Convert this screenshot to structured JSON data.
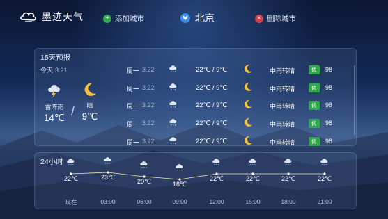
{
  "header": {
    "app_name": "墨迹天气",
    "add_city": "添加城市",
    "current_city": "北京",
    "delete_city": "删除城市"
  },
  "forecast15": {
    "title": "15天预报",
    "today_label": "今天",
    "today_date": "3.21",
    "day": {
      "label": "雷阵雨",
      "temp": "14℃",
      "icon": "thunderstorm-icon"
    },
    "night": {
      "label": "晴",
      "temp": "9℃",
      "icon": "moon-icon"
    },
    "rows": [
      {
        "day": "周一",
        "date": "3.22",
        "temp": "22℃ / 9℃",
        "desc": "中雨转晴",
        "aqi_label": "优",
        "aqi": "98"
      },
      {
        "day": "周一",
        "date": "3.22",
        "temp": "22℃ / 9℃",
        "desc": "中雨转晴",
        "aqi_label": "优",
        "aqi": "98"
      },
      {
        "day": "周一",
        "date": "3.22",
        "temp": "22℃ / 9℃",
        "desc": "中雨转晴",
        "aqi_label": "优",
        "aqi": "98"
      },
      {
        "day": "周一",
        "date": "3.22",
        "temp": "22℃ / 9℃",
        "desc": "中雨转晴",
        "aqi_label": "优",
        "aqi": "98"
      },
      {
        "day": "周一",
        "date": "3.22",
        "temp": "22℃ / 9℃",
        "desc": "中雨转晴",
        "aqi_label": "优",
        "aqi": "98"
      }
    ]
  },
  "hourly": {
    "title": "24小时",
    "items": [
      {
        "temp": "22℃",
        "time": "现在",
        "value": 22
      },
      {
        "temp": "23℃",
        "time": "03:00",
        "value": 23
      },
      {
        "temp": "20℃",
        "time": "06:00",
        "value": 20
      },
      {
        "temp": "18℃",
        "time": "09:00",
        "value": 18
      },
      {
        "temp": "22℃",
        "time": "12:00",
        "value": 22
      },
      {
        "temp": "22℃",
        "time": "15:00",
        "value": 22
      },
      {
        "temp": "22℃",
        "time": "18:00",
        "value": 22
      },
      {
        "temp": "22℃",
        "time": "21:00",
        "value": 22
      }
    ]
  },
  "colors": {
    "aqi_good": "#2ea84a",
    "accent": "#3b8ee8",
    "delete": "#d6404a"
  }
}
